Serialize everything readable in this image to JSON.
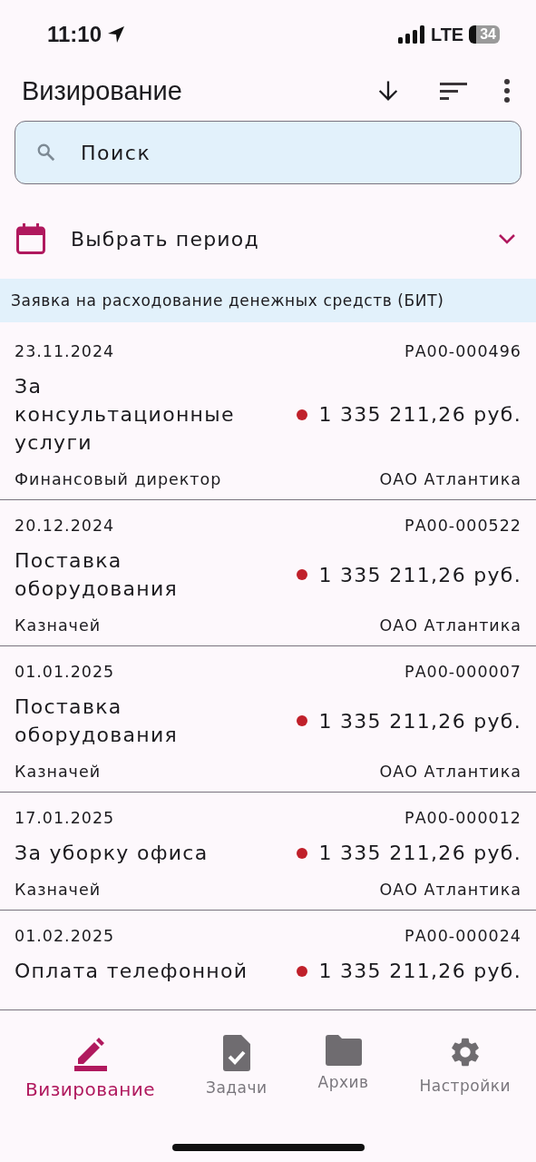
{
  "status_bar": {
    "time": "11:10",
    "network": "LTE",
    "battery": "34"
  },
  "header": {
    "title": "Визирование"
  },
  "search": {
    "placeholder": "Поиск"
  },
  "period": {
    "label": "Выбрать период",
    "expanded": false
  },
  "group": {
    "title": "Заявка на расходование денежных средств (БИТ)"
  },
  "items": [
    {
      "date": "23.11.2024",
      "number": "РА00-000496",
      "title": "За консультационные услуги",
      "amount": "1 335 211,26 руб.",
      "role": "Финансовый директор",
      "org": "ОАО Атлантика"
    },
    {
      "date": "20.12.2024",
      "number": "РА00-000522",
      "title": "Поставка оборудования",
      "amount": "1 335 211,26 руб.",
      "role": "Казначей",
      "org": "ОАО Атлантика"
    },
    {
      "date": "01.01.2025",
      "number": "РА00-000007",
      "title": "Поставка оборудования",
      "amount": "1 335 211,26 руб.",
      "role": "Казначей",
      "org": "ОАО Атлантика"
    },
    {
      "date": "17.01.2025",
      "number": "РА00-000012",
      "title": "За уборку офиса",
      "amount": "1 335 211,26 руб.",
      "role": "Казначей",
      "org": "ОАО Атлантика"
    },
    {
      "date": "01.02.2025",
      "number": "РА00-000024",
      "title": "Оплата телефонной",
      "amount": "1 335 211,26 руб."
    }
  ],
  "nav": [
    {
      "kind": "sign",
      "label": "Визирование",
      "selected": true
    },
    {
      "kind": "tasks",
      "label": "Задачи",
      "selected": false
    },
    {
      "kind": "archive",
      "label": "Архив",
      "selected": false
    },
    {
      "kind": "settings",
      "label": "Настройки",
      "selected": false
    }
  ]
}
